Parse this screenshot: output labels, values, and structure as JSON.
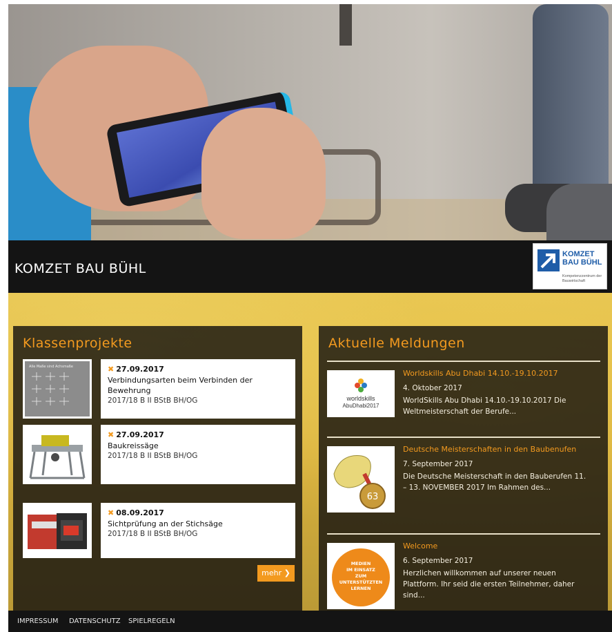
{
  "header": {
    "site_title": "KOMZET BAU BÜHL",
    "logo": {
      "line1": "KOMZET",
      "line2": "BAU BÜHL",
      "sub": "Kompetenzzentrum der Bauwirtschaft"
    }
  },
  "projects": {
    "heading": "Klassenprojekte",
    "items": [
      {
        "date": "27.09.2017",
        "title": "Verbindungsarten beim Verbinden der Bewehrung",
        "meta": "2017/18 B II BStB BH/OG",
        "thumb": "drawing-sheet"
      },
      {
        "date": "27.09.2017",
        "title": "Baukreissäge",
        "meta": "2017/18 B II BStB BH/OG",
        "thumb": "table-saw"
      },
      {
        "date": "08.09.2017",
        "title": "Sichtprüfung an der Stichsäge",
        "meta": "2017/18 B II BStB BH/OG",
        "thumb": "jigsaw-case"
      }
    ],
    "more_label": "mehr ❯",
    "date_icon": "tools-icon"
  },
  "news": {
    "heading": "Aktuelle Meldungen",
    "items": [
      {
        "headline": "Worldskills Abu Dhabi 14.10.-19.10.2017",
        "date": "4. Oktober 2017",
        "text": "WorldSkills Abu Dhabi 14.10.-19.10.2017 Die Weltmeisterschaft der Berufe...",
        "thumb": "worldskills-logo"
      },
      {
        "headline": "Deutsche Meisterschaften in den Baubenufen",
        "date": "7. September 2017",
        "text": "Die Deutsche Meisterschaft in den Bauberufen 11. – 13. NOVEMBER 2017 Im Rahmen des...",
        "thumb": "medal-glove"
      },
      {
        "headline": "Welcome",
        "date": "6. September 2017",
        "text": "Herzlichen willkommen auf unserer neuen Plattform. Ihr seid die ersten Teilnehmer, daher sind...",
        "thumb": "medien-badge"
      }
    ],
    "worldskills_text": {
      "line1": "worldskills",
      "line2": "AbuDhabi2017"
    },
    "medal_number": "63",
    "badge_text": {
      "line1": "MEDIEN",
      "line2": "IM EINSATZ",
      "line3": "ZUM",
      "line4": "UNTERSTÜTZTEN",
      "line5": "LERNEN"
    },
    "drawing_title": "Alle Maße sind Achsmaße"
  },
  "footer": {
    "links": [
      "IMPRESSUM",
      "DATENSCHUTZ",
      "SPIELREGELN"
    ]
  },
  "colors": {
    "accent": "#f39a1f",
    "dark": "#141414",
    "brand_blue": "#1f5da8"
  }
}
